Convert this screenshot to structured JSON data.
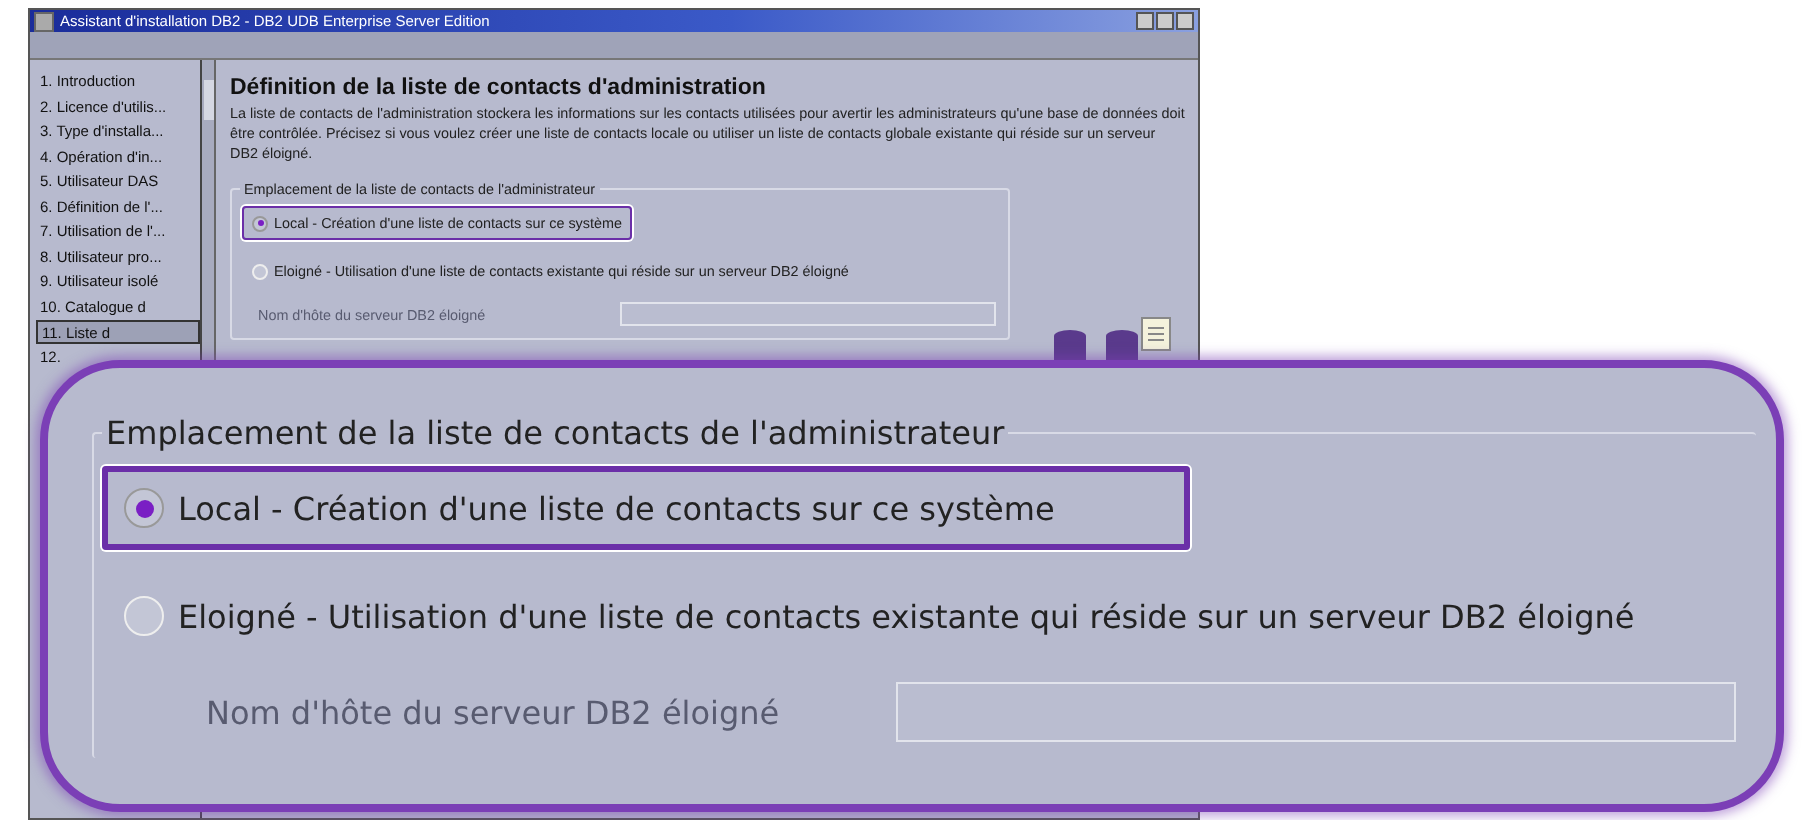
{
  "window": {
    "title": "Assistant d'installation DB2 - DB2 UDB Enterprise Server Edition"
  },
  "sidebar": {
    "items": [
      {
        "label": "1. Introduction",
        "selected": false
      },
      {
        "label": "2. Licence d'utilis...",
        "selected": false
      },
      {
        "label": "3. Type d'installa...",
        "selected": false
      },
      {
        "label": "4. Opération d'in...",
        "selected": false
      },
      {
        "label": "5. Utilisateur DAS",
        "selected": false
      },
      {
        "label": "6. Définition de l'...",
        "selected": false
      },
      {
        "label": "7. Utilisation de l'...",
        "selected": false
      },
      {
        "label": "8. Utilisateur pro...",
        "selected": false
      },
      {
        "label": "9. Utilisateur isolé",
        "selected": false
      },
      {
        "label": "10. Catalogue d",
        "selected": false
      },
      {
        "label": "11. Liste d",
        "selected": true
      },
      {
        "label": "12.",
        "selected": false
      }
    ]
  },
  "page": {
    "heading": "Définition de la liste de contacts d'administration",
    "description": "La liste de contacts de l'administration stockera les informations sur les contacts utilisées pour avertir les administrateurs qu'une base de données doit être contrôlée. Précisez si vous voulez créer une liste de contacts locale ou utiliser un liste de contacts globale existante qui réside sur un serveur DB2 éloigné."
  },
  "group": {
    "legend": "Emplacement de la liste de contacts de l'administrateur",
    "options": [
      {
        "label": "Local - Création d'une liste de contacts sur ce système",
        "selected": true
      },
      {
        "label": "Eloigné - Utilisation d'une liste de contacts existante qui réside sur un serveur DB2 éloigné",
        "selected": false
      }
    ],
    "host_field": {
      "label": "Nom d'hôte du serveur DB2 éloigné",
      "disabled": true
    }
  },
  "callout": {
    "legend": "Emplacement de la liste de contacts de l'administrateur",
    "options": [
      {
        "label": "Local - Création d'une liste de contacts sur ce système",
        "selected": true
      },
      {
        "label": "Eloigné - Utilisation d'une liste de contacts existante qui réside sur un serveur DB2 éloigné",
        "selected": false
      }
    ],
    "host_field": {
      "label": "Nom d'hôte du serveur DB2 éloigné",
      "disabled": true
    }
  }
}
